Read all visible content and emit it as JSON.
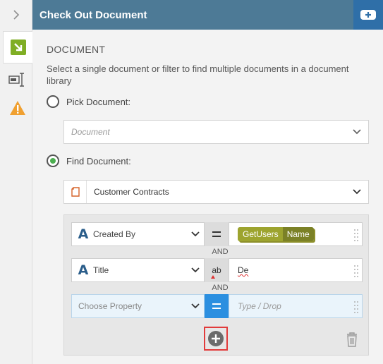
{
  "header": {
    "title": "Check Out Document"
  },
  "section": {
    "title": "DOCUMENT",
    "description": "Select a single document or filter to find multiple documents in a document library"
  },
  "pick_option": {
    "label": "Pick Document:",
    "selected": false,
    "placeholder": "Document"
  },
  "find_option": {
    "label": "Find Document:",
    "selected": true,
    "library": "Customer Contracts"
  },
  "conditions": [
    {
      "property": "Created By",
      "operator_icon": "equals-icon",
      "value_tag": [
        "GetUsers",
        "Name"
      ]
    },
    {
      "property": "Title",
      "operator_icon": "text-compare-icon",
      "operator_glyph": "ab",
      "value": "De"
    },
    {
      "property": "Choose Property",
      "operator_icon": "equals-icon",
      "value_placeholder": "Type / Drop"
    }
  ],
  "connector": "AND",
  "colors": {
    "header": "#4d7a96",
    "accent": "#2f6fa8",
    "tag": "#9da42f",
    "radio_checked": "#4caf50",
    "highlight": "#e23b3b"
  }
}
